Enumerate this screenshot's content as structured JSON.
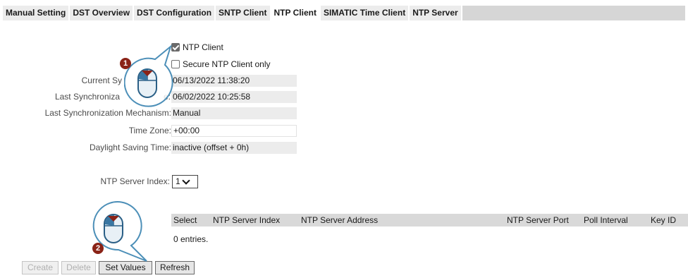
{
  "tabs": [
    {
      "label": "Manual Setting",
      "active": false
    },
    {
      "label": "DST Overview",
      "active": false
    },
    {
      "label": "DST Configuration",
      "active": false
    },
    {
      "label": "SNTP Client",
      "active": false
    },
    {
      "label": "NTP Client",
      "active": true
    },
    {
      "label": "SIMATIC Time Client",
      "active": false
    },
    {
      "label": "NTP Server",
      "active": false
    }
  ],
  "form": {
    "ntp_client_label": "NTP Client",
    "ntp_client_checked": true,
    "secure_label": "Secure NTP Client only",
    "secure_checked": false,
    "current_time_label": "Current Sy",
    "current_time_value": "06/13/2022 11:38:20",
    "last_sync_label": "Last Synchroniza",
    "last_sync_label_tail": "e:",
    "last_sync_value": "06/02/2022 10:25:58",
    "mechanism_label": "Last Synchronization Mechanism:",
    "mechanism_value": "Manual",
    "timezone_label": "Time Zone:",
    "timezone_value": "+00:00",
    "dst_label": "Daylight Saving Time:",
    "dst_value": "inactive (offset + 0h)",
    "server_index_label": "NTP Server Index:",
    "server_index_value": "1"
  },
  "table": {
    "columns": [
      "Select",
      "NTP Server Index",
      "NTP Server Address",
      "NTP Server Port",
      "Poll Interval",
      "Key ID"
    ],
    "entries_text": "0 entries."
  },
  "buttons": {
    "create": "Create",
    "delete": "Delete",
    "set_values": "Set Values",
    "refresh": "Refresh"
  },
  "callouts": {
    "one": "1",
    "two": "2"
  },
  "colors": {
    "badge": "#8a2317",
    "callout_blue": "#4c8fb8"
  }
}
